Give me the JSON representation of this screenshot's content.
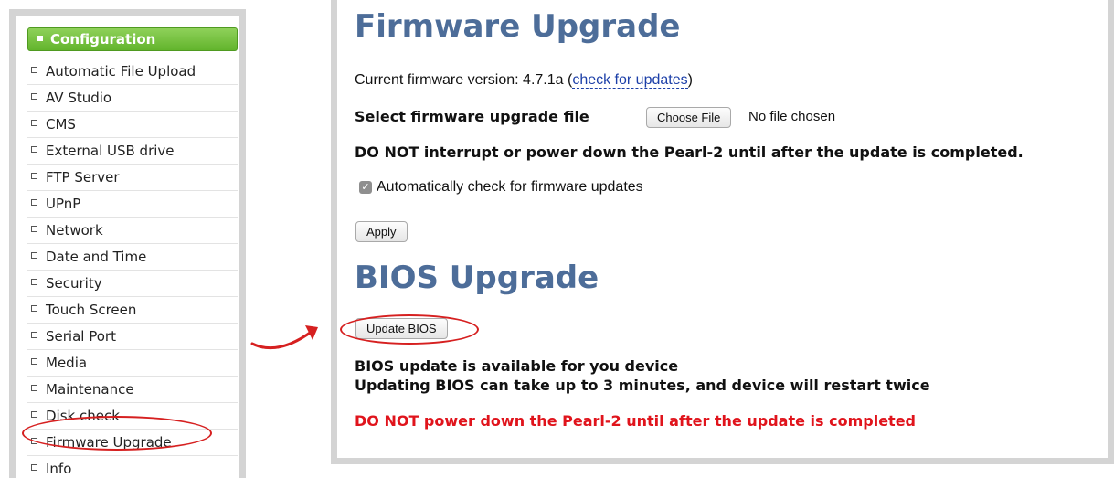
{
  "sidebar": {
    "header": "Configuration",
    "items": [
      {
        "label": "Automatic File Upload"
      },
      {
        "label": "AV Studio"
      },
      {
        "label": "CMS"
      },
      {
        "label": "External USB drive"
      },
      {
        "label": "FTP Server"
      },
      {
        "label": "UPnP"
      },
      {
        "label": "Network"
      },
      {
        "label": "Date and Time"
      },
      {
        "label": "Security"
      },
      {
        "label": "Touch Screen"
      },
      {
        "label": "Serial Port"
      },
      {
        "label": "Media"
      },
      {
        "label": "Maintenance"
      },
      {
        "label": "Disk check"
      },
      {
        "label": "Firmware Upgrade"
      },
      {
        "label": "Info"
      }
    ]
  },
  "firmware": {
    "title": "Firmware Upgrade",
    "current_version_label": "Current firmware version: 4.7.1a (",
    "check_updates_link": "check for updates",
    "close_paren": ")",
    "select_file_label": "Select firmware upgrade file",
    "choose_file_button": "Choose File",
    "no_file_text": "No file chosen",
    "warning": "DO NOT interrupt or power down the Pearl-2 until after the update is completed.",
    "auto_check_label": "Automatically check for firmware updates",
    "auto_check_checked": true,
    "apply_button": "Apply"
  },
  "bios": {
    "title": "BIOS Upgrade",
    "update_button": "Update BIOS",
    "available_text": "BIOS update is available for you device",
    "duration_text": "Updating BIOS can take up to 3 minutes, and device will restart twice",
    "warning": "DO NOT power down the Pearl-2 until after the update is completed"
  },
  "colors": {
    "header_green": "#62b42c",
    "title_blue": "#4d6d99",
    "warning_red": "#e0141c",
    "annotation_red": "#d62020",
    "link_blue": "#1c3fa8"
  }
}
